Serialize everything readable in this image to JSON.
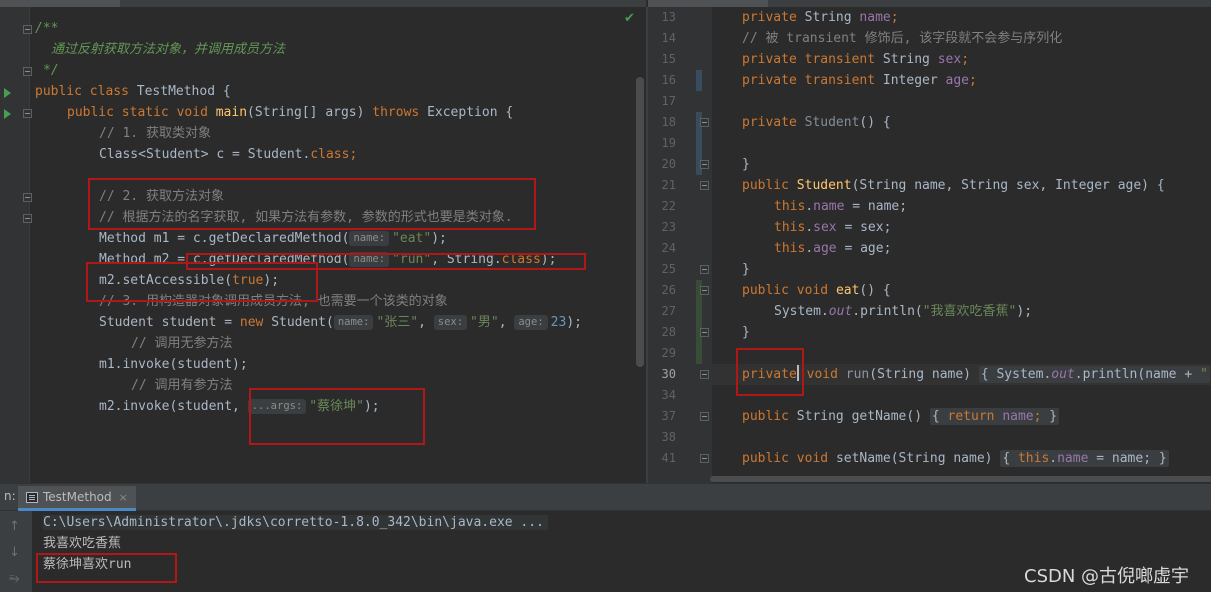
{
  "left": {
    "doc_open": "/**",
    "doc_text": "通过反射获取方法对象，并调用成员方法",
    "doc_close": "*/",
    "c_public": "public",
    "c_class": "class",
    "class_name": "TestMethod",
    "open_brace": "{",
    "c_static": "static",
    "c_void": "void",
    "main_name": "main",
    "main_params": "(String[] args)",
    "c_throws": "throws",
    "exception": "Exception {",
    "cmt1": "// 1. 获取类对象",
    "line_class_a": "Class<Student> c = Student.",
    "c_classkw": "class",
    "semi": ";",
    "cmt2": "// 2. 获取方法对象",
    "cmt3": "// 根据方法的名字获取, 如果方法有参数, 参数的形式也要是类对象.",
    "m1_decl": "Method m1 = c.getDeclaredMethod(",
    "hint_name": "name:",
    "str_eat": "\"eat\"",
    "close_paren_semi": ");",
    "m2_decl": "Method m2 = c.getDeclaredMethod(",
    "str_run": "\"run\"",
    "string_class": ", String.",
    "set_access": "m2.setAccessible(",
    "c_true": "true",
    "cmt4": "// 3. 用构造器对象调用成员方法, 也需要一个该类的对象",
    "student_decl": "Student student = ",
    "c_new": "new",
    "student_ctor": " Student(",
    "str_zhangsan": "\"张三\"",
    "comma": ", ",
    "hint_sex": "sex:",
    "str_nan": "\"男\"",
    "hint_age": "age:",
    "num_23": "23",
    "cmt5": "// 调用无参方法",
    "invoke1": "m1.invoke(student);",
    "cmt6": "// 调用有参方法",
    "invoke2": "m2.invoke(student, ",
    "hint_args": "...args:",
    "str_kun": "\"蔡徐坤\""
  },
  "right": {
    "line_numbers": [
      "13",
      "14",
      "15",
      "16",
      "17",
      "18",
      "19",
      "20",
      "21",
      "22",
      "23",
      "24",
      "25",
      "26",
      "27",
      "28",
      "29",
      "30",
      "34",
      "37",
      "38",
      "41"
    ],
    "c_private": "private",
    "c_public": "public",
    "c_transient": "transient",
    "c_void": "void",
    "c_this": "this",
    "c_return": "return",
    "t_string": "String",
    "t_integer": "Integer",
    "f_name": "name",
    "f_sex": "sex",
    "f_age": "age",
    "semi": ";",
    "cmt14": "// 被 transient 修饰后, 该字段就不会参与序列化",
    "student_name": "Student",
    "empty_params": "() {",
    "close_brace": "}",
    "ctor_params": "(String name, String sex, Integer age) {",
    "assign_name": " = name;",
    "assign_sex": " = sex;",
    "assign_age": " = age;",
    "eat_name": "eat",
    "sys_out": "System.",
    "out_field": "out",
    "println_eat": ".println(",
    "str_banana": "\"我喜欢吃香蕉\"",
    "close_paren_semi": ");",
    "run_name": "run",
    "run_params": "(String name) ",
    "fold_open": "{",
    "println_run": ".println(name + ",
    "quote_cut": "\"",
    "getname_name": "getName",
    "getname_parens": "() ",
    "setname_name": "setName",
    "setname_params": "(String name) ",
    "dot": "."
  },
  "run": {
    "label": "n:",
    "tab_title": "TestMethod",
    "tab_close": "×",
    "cmd_line": "C:\\Users\\Administrator\\.jdks\\corretto-1.8.0_342\\bin\\java.exe ...",
    "output1": "我喜欢吃香蕉",
    "output2": "蔡徐坤喜欢run",
    "watermark": "CSDN @古倪啷虚宇"
  },
  "icons": {
    "check": "✔",
    "up": "↑",
    "down": "↓",
    "wrap": "⥱"
  }
}
